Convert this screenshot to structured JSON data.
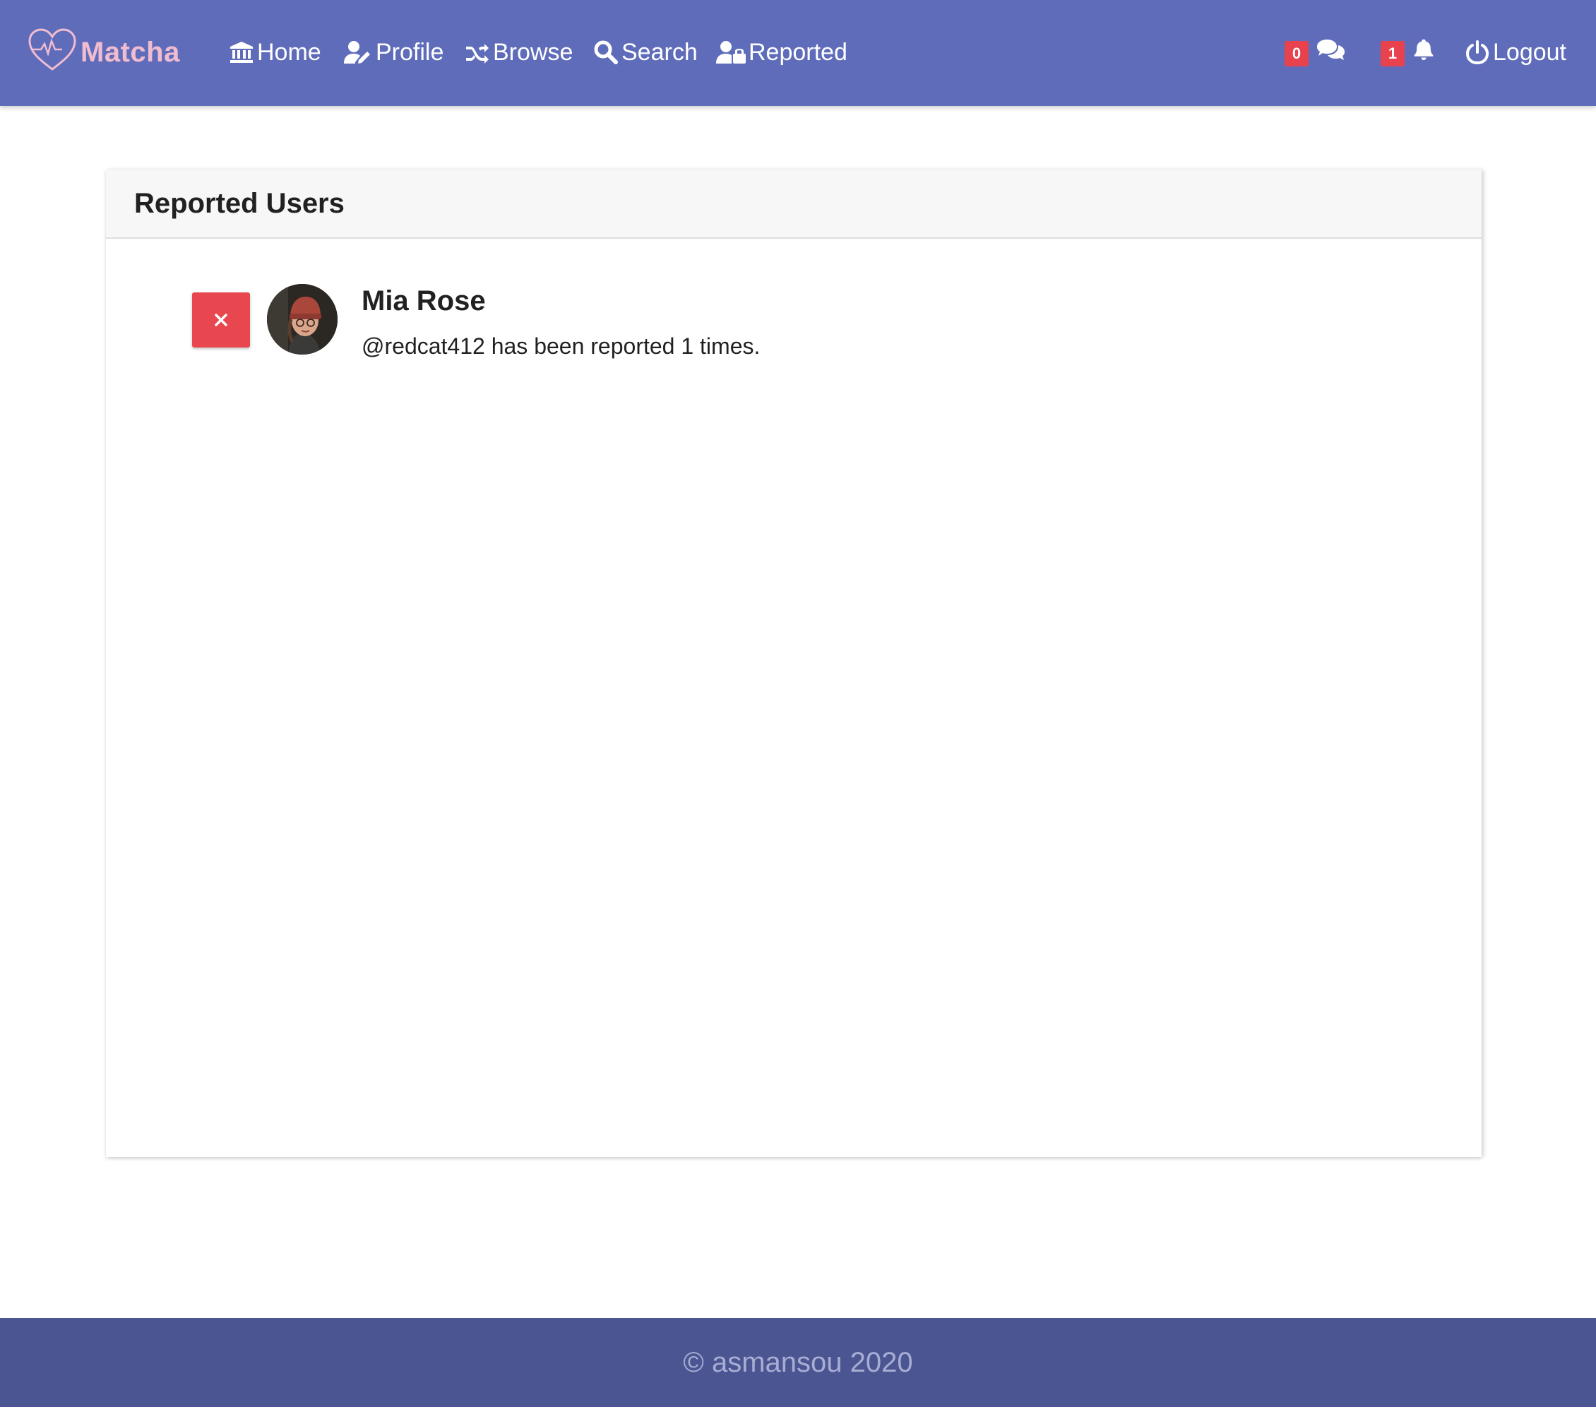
{
  "brand": {
    "name": "Matcha"
  },
  "nav": {
    "links": [
      {
        "label": "Home",
        "icon": "university-icon"
      },
      {
        "label": "Profile",
        "icon": "user-edit-icon"
      },
      {
        "label": "Browse",
        "icon": "shuffle-icon"
      },
      {
        "label": "Search",
        "icon": "search-icon"
      },
      {
        "label": "Reported",
        "icon": "user-lock-icon"
      }
    ],
    "messages_count": "0",
    "notifications_count": "1",
    "logout_label": "Logout"
  },
  "colors": {
    "navbar": "#5f6cba",
    "footer": "#4b5592",
    "badge": "#e8424f",
    "brand_text": "#f0bcd0",
    "remove_button": "#e8474f"
  },
  "reported": {
    "title": "Reported Users",
    "users": [
      {
        "name": "Mia Rose",
        "message": "@redcat412 has been reported 1 times."
      }
    ]
  },
  "footer": {
    "text": "© asmansou 2020"
  }
}
